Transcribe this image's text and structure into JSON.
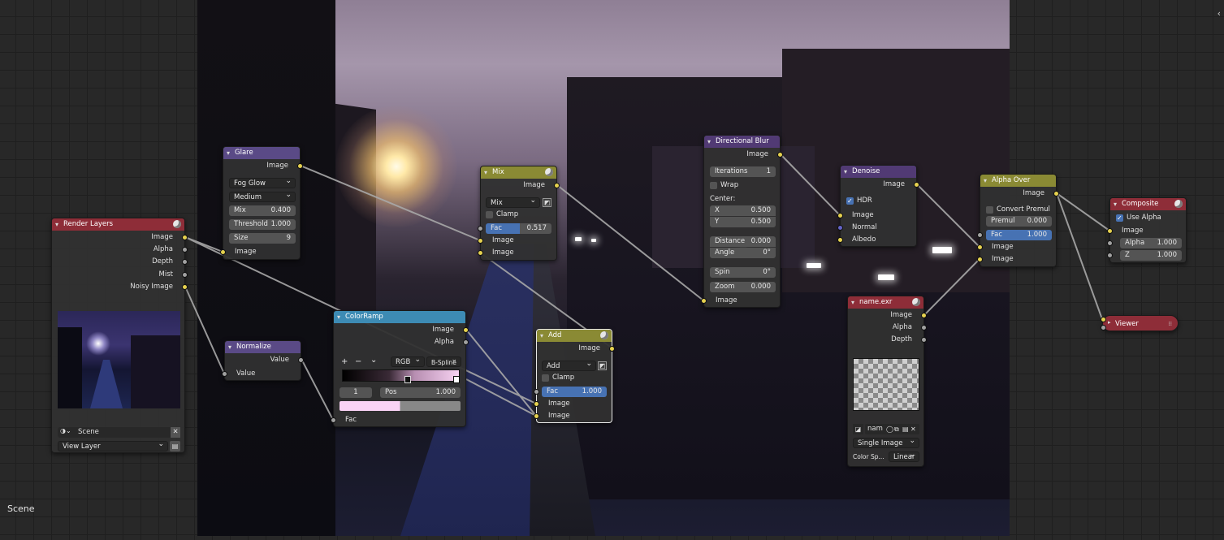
{
  "scene_label": "Scene",
  "nodes": {
    "render_layers": {
      "title": "Render Layers",
      "outputs": [
        "Image",
        "Alpha",
        "Depth",
        "Mist",
        "Noisy Image"
      ],
      "scene": "Scene",
      "view_layer": "View Layer"
    },
    "glare": {
      "title": "Glare",
      "output": "Image",
      "type": "Fog Glow",
      "quality": "Medium",
      "mix_label": "Mix",
      "mix": "0.400",
      "threshold_label": "Threshold",
      "threshold": "1.000",
      "size_label": "Size",
      "size": "9",
      "input": "Image"
    },
    "normalize": {
      "title": "Normalize",
      "output": "Value",
      "input": "Value"
    },
    "colorramp": {
      "title": "ColorRamp",
      "outputs": [
        "Image",
        "Alpha"
      ],
      "plus": "+",
      "minus": "−",
      "chev": "⌄",
      "mode": "RGB",
      "interp": "B-Spline",
      "index": "1",
      "pos_label": "Pos",
      "pos": "1.000",
      "input": "Fac"
    },
    "mix": {
      "title": "Mix",
      "output": "Image",
      "blend": "Mix",
      "clamp": "Clamp",
      "fac_label": "Fac",
      "fac": "0.517",
      "inputs": [
        "Image",
        "Image"
      ]
    },
    "add": {
      "title": "Add",
      "output": "Image",
      "blend": "Add",
      "clamp": "Clamp",
      "fac_label": "Fac",
      "fac": "1.000",
      "inputs": [
        "Image",
        "Image"
      ]
    },
    "dblur": {
      "title": "Directional Blur",
      "output": "Image",
      "iter_label": "Iterations",
      "iterations": "1",
      "wrap": "Wrap",
      "center": "Center:",
      "x_label": "X",
      "x": "0.500",
      "y_label": "Y",
      "y": "0.500",
      "distance_label": "Distance",
      "distance": "0.000",
      "angle_label": "Angle",
      "angle": "0°",
      "spin_label": "Spin",
      "spin": "0°",
      "zoom_label": "Zoom",
      "zoom": "0.000",
      "input": "Image"
    },
    "denoise": {
      "title": "Denoise",
      "output": "Image",
      "hdr": "HDR",
      "inputs": [
        "Image",
        "Normal",
        "Albedo"
      ]
    },
    "exr": {
      "title": "name.exr",
      "outputs": [
        "Image",
        "Alpha",
        "Depth"
      ],
      "filename": "nam",
      "source": "Single Image",
      "colorspace_label": "Color Sp...",
      "colorspace": "Linear"
    },
    "alphaover": {
      "title": "Alpha Over",
      "output": "Image",
      "convert": "Convert Premul",
      "premul_label": "Premul",
      "premul": "0.000",
      "fac_label": "Fac",
      "fac": "1.000",
      "inputs": [
        "Image",
        "Image"
      ]
    },
    "composite": {
      "title": "Composite",
      "use_alpha": "Use Alpha",
      "inputs": [
        "Image"
      ],
      "alpha_label": "Alpha",
      "alpha": "1.000",
      "z_label": "Z",
      "z": "1.000"
    },
    "viewer": {
      "title": "Viewer"
    }
  },
  "colors": {
    "header_red": "#8e2d38",
    "header_purple": "#5a4a86",
    "header_yellow": "#8a8a34",
    "header_blue": "#3d8bb4",
    "socket_image": "#e6d24f",
    "socket_value": "#a1a1a1",
    "socket_vector": "#6363c7",
    "accent": "#4772b3"
  }
}
